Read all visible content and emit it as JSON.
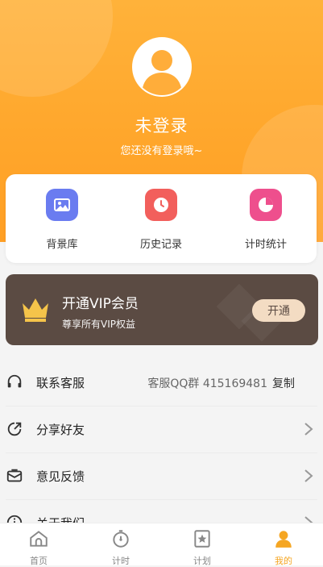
{
  "profile": {
    "username": "未登录",
    "subtitle": "您还没有登录哦~"
  },
  "quick_actions": [
    {
      "label": "背景库",
      "icon": "image-icon",
      "color": "#6a7cf0"
    },
    {
      "label": "历史记录",
      "icon": "clock-icon",
      "color": "#f25f5c"
    },
    {
      "label": "计时统计",
      "icon": "pie-chart-icon",
      "color": "#ee4f8d"
    }
  ],
  "vip": {
    "title": "开通VIP会员",
    "subtitle": "尊享所有VIP权益",
    "button": "开通",
    "icon": "crown-icon"
  },
  "menu": [
    {
      "label": "联系客服",
      "icon": "headset-icon",
      "extra": "客服QQ群 415169481",
      "action": "复制"
    },
    {
      "label": "分享好友",
      "icon": "share-icon"
    },
    {
      "label": "意见反馈",
      "icon": "feedback-icon"
    },
    {
      "label": "关于我们",
      "icon": "info-icon"
    }
  ],
  "tabbar": [
    {
      "label": "首页",
      "icon": "home-icon"
    },
    {
      "label": "计时",
      "icon": "stopwatch-icon"
    },
    {
      "label": "计划",
      "icon": "plan-icon"
    },
    {
      "label": "我的",
      "icon": "profile-icon",
      "active": true
    }
  ],
  "colors": {
    "accent": "#f5a623",
    "header": "#ffa62b",
    "vip_bg": "#5b4b43"
  }
}
